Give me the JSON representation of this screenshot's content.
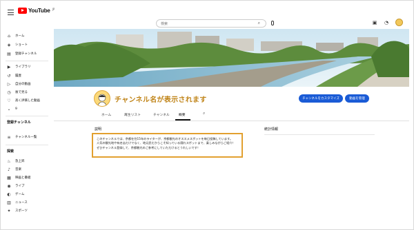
{
  "app": {
    "logo_text": "YouTube",
    "logo_sup": "JP"
  },
  "search": {
    "placeholder": "検索"
  },
  "sidebar": {
    "main_items": [
      {
        "label": "ホーム",
        "icon": "home-icon"
      },
      {
        "label": "ショート",
        "icon": "shorts-icon"
      },
      {
        "label": "登録チャンネル",
        "icon": "subscriptions-icon"
      }
    ],
    "library_items": [
      {
        "label": "ライブラリ",
        "icon": "library-icon"
      },
      {
        "label": "履歴",
        "icon": "history-icon"
      },
      {
        "label": "自分の動画",
        "icon": "my-videos-icon"
      },
      {
        "label": "後で見る",
        "icon": "watch-later-icon"
      },
      {
        "label": "高く評価した動画",
        "icon": "liked-icon"
      },
      {
        "label": "9",
        "icon": "chevron-down-icon"
      }
    ],
    "subscriptions_heading": "登録チャンネル",
    "subscription_items": [
      {
        "label": "チャンネル一覧",
        "icon": "list-icon"
      }
    ],
    "explore_heading": "探索",
    "explore_items": [
      {
        "label": "急上昇",
        "icon": "trending-icon"
      },
      {
        "label": "音楽",
        "icon": "music-icon"
      },
      {
        "label": "映画と番組",
        "icon": "movies-icon"
      },
      {
        "label": "ライブ",
        "icon": "live-icon"
      },
      {
        "label": "ゲーム",
        "icon": "gaming-icon"
      },
      {
        "label": "ニュース",
        "icon": "news-icon"
      },
      {
        "label": "スポーツ",
        "icon": "sports-icon"
      }
    ]
  },
  "channel": {
    "name": "チャンネル名が表示されます",
    "customize_button": "チャンネルをカスタマイズ",
    "manage_button": "動画を管理"
  },
  "tabs": [
    {
      "label": "ホーム",
      "active": false
    },
    {
      "label": "再生リスト",
      "active": false
    },
    {
      "label": "チャンネル",
      "active": false
    },
    {
      "label": "概要",
      "active": true
    }
  ],
  "about": {
    "description_label": "説明",
    "stats_label": "統計情報",
    "description_lines": [
      "このチャンネルでは、京都在住15年のライターが、京都観光のオススメスポットを毎日投稿しています。",
      "人気の観光地や有名店だけでなく、地元民だからこそ知っている隠れスポットまで、楽しみながらご紹介！",
      "ぜひチャンネル登録して、京都観光のご参考にしていただけるとうれしいです！"
    ]
  },
  "colors": {
    "accent_orange": "#e2a02f",
    "channel_name": "#c08418",
    "button_blue": "#1a5bd6",
    "youtube_red": "#ff0000"
  }
}
